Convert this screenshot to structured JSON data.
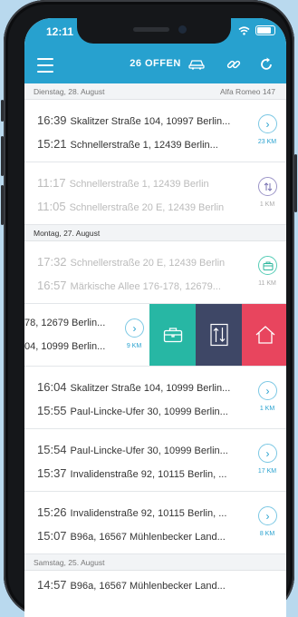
{
  "status_bar": {
    "time": "12:11"
  },
  "header": {
    "title": "26 OFFEN"
  },
  "icons": {
    "menu": "hamburger-icon",
    "car": "car-icon",
    "link": "link-icon",
    "refresh": "refresh-icon",
    "arrow": "chevron-right-icon",
    "briefcase": "briefcase-icon",
    "swap": "swap-arrows-icon",
    "home": "home-icon"
  },
  "colors": {
    "primary": "#27a1cf",
    "teal": "#27b7a4",
    "navy": "#3e4766",
    "red": "#e8455e"
  },
  "groups": [
    {
      "date": "Dienstag, 28. August",
      "vehicle": "Alfa Romeo 147",
      "trips": [
        {
          "t1": "16:39",
          "a1": "Skalitzer Straße 104, 10997 Berlin...",
          "t2": "15:21",
          "a2": "Schnellerstraße 1, 12439 Berlin...",
          "km": "23 KM"
        },
        {
          "t1": "11:17",
          "a1": "Schnellerstraße 1, 12439 Berlin",
          "t2": "11:05",
          "a2": "Schnellerstraße 20 E, 12439 Berlin",
          "km": "1 KM"
        }
      ]
    },
    {
      "date": "Montag, 27. August",
      "trips": [
        {
          "t1": "17:32",
          "a1": "Schnellerstraße 20 E, 12439 Berlin",
          "t2": "16:57",
          "a2": "Märkische Allee 176-178, 12679...",
          "km": "11 KM"
        },
        {
          "a1": "78, 12679 Berlin...",
          "a2": "04, 10999 Berlin...",
          "km": "9 KM"
        },
        {
          "t1": "16:04",
          "a1": "Skalitzer Straße 104, 10999 Berlin...",
          "t2": "15:55",
          "a2": "Paul-Lincke-Ufer 30, 10999 Berlin...",
          "km": "1 KM"
        },
        {
          "t1": "15:54",
          "a1": "Paul-Lincke-Ufer 30, 10999 Berlin...",
          "t2": "15:37",
          "a2": "Invalidenstraße 92, 10115 Berlin, ...",
          "km": "17 KM"
        },
        {
          "t1": "15:26",
          "a1": "Invalidenstraße 92, 10115 Berlin, ...",
          "t2": "15:07",
          "a2": "B96a, 16567 Mühlenbecker Land...",
          "km": "8 KM"
        }
      ]
    },
    {
      "date": "Samstag, 25. August",
      "trips": [
        {
          "t1": "14:57",
          "a1": "B96a, 16567 Mühlenbecker Land..."
        }
      ]
    }
  ]
}
